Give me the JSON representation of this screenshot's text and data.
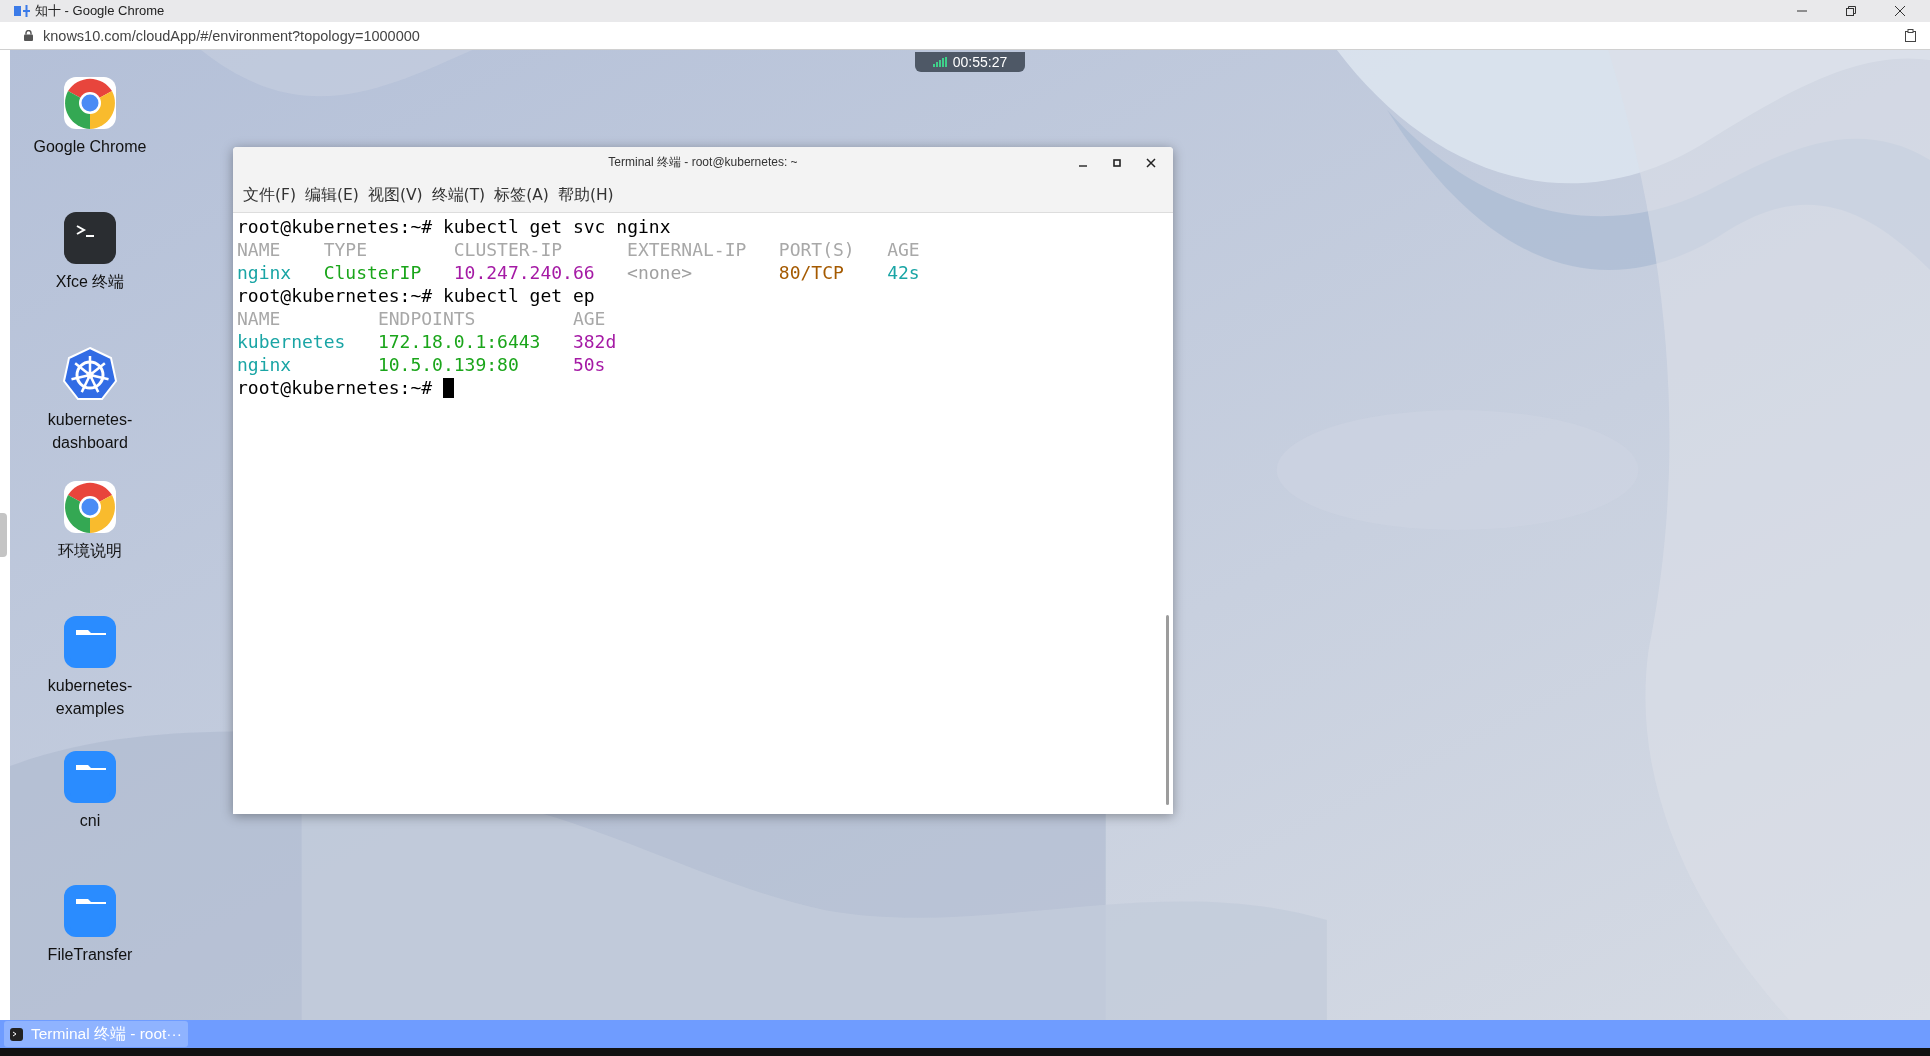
{
  "browser": {
    "title": "知十 - Google Chrome",
    "url": "knows10.com/cloudApp/#/environment?topology=1000000"
  },
  "timer": "00:55:27",
  "desktop_icons": [
    {
      "kind": "chrome",
      "label": "Google Chrome"
    },
    {
      "kind": "terminal",
      "label": "Xfce 终端"
    },
    {
      "kind": "kubernetes",
      "label": "kubernetes-dashboard"
    },
    {
      "kind": "chrome",
      "label": "环境说明"
    },
    {
      "kind": "folder",
      "label": "kubernetes-examples"
    },
    {
      "kind": "folder",
      "label": "cni"
    },
    {
      "kind": "folder",
      "label": "FileTransfer"
    }
  ],
  "terminal": {
    "title": "Terminal 终端 - root@kubernetes: ~",
    "menu": [
      "文件(F)",
      "编辑(E)",
      "视图(V)",
      "终端(T)",
      "标签(A)",
      "帮助(H)"
    ],
    "blocks": [
      {
        "kind": "command",
        "prompt": "root@kubernetes:~#",
        "command": "kubectl get svc nginx"
      },
      {
        "kind": "table",
        "header": [
          "NAME",
          "TYPE",
          "CLUSTER-IP",
          "EXTERNAL-IP",
          "PORT(S)",
          "AGE"
        ],
        "rows": [
          {
            "cells": [
              {
                "text": "nginx",
                "color": "#1aa5a5"
              },
              {
                "text": "ClusterIP",
                "color": "#1aa51a"
              },
              {
                "text": "10.247.240.66",
                "color": "#a51aa5"
              },
              {
                "text": "<none>",
                "color": "#a0a0a0"
              },
              {
                "text": "80/TCP",
                "color": "#a55a00"
              },
              {
                "text": "42s",
                "color": "#1aa5a5"
              }
            ]
          }
        ]
      },
      {
        "kind": "command",
        "prompt": "root@kubernetes:~#",
        "command": "kubectl get ep"
      },
      {
        "kind": "table",
        "header": [
          "NAME",
          "ENDPOINTS",
          "AGE"
        ],
        "rows": [
          {
            "cells": [
              {
                "text": "kubernetes",
                "color": "#1aa5a5"
              },
              {
                "text": "172.18.0.1:6443",
                "color": "#1aa51a"
              },
              {
                "text": "382d",
                "color": "#a51aa5"
              }
            ]
          },
          {
            "cells": [
              {
                "text": "nginx",
                "color": "#1aa5a5"
              },
              {
                "text": "10.5.0.139:80",
                "color": "#1aa51a"
              },
              {
                "text": "50s",
                "color": "#a51aa5"
              }
            ]
          }
        ]
      },
      {
        "kind": "command",
        "prompt": "root@kubernetes:~#",
        "cursor": true
      }
    ]
  },
  "taskbar": {
    "tasks": [
      {
        "label": "Terminal 终端 - root···",
        "selected": true
      }
    ]
  }
}
